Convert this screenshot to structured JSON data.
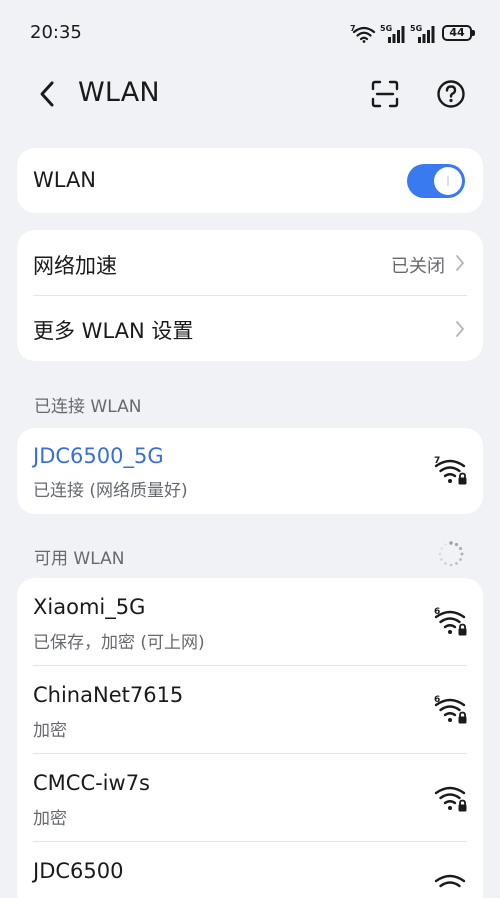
{
  "status_bar": {
    "time": "20:35",
    "network_badges": [
      "7",
      "5G",
      "5G"
    ],
    "battery": "44"
  },
  "header": {
    "title": "WLAN",
    "back_icon": "chevron-left-icon",
    "scan_icon": "scan-icon",
    "help_icon": "help-circle-icon"
  },
  "wlan_toggle": {
    "label": "WLAN",
    "enabled": true
  },
  "settings": [
    {
      "label": "网络加速",
      "value": "已关闭"
    },
    {
      "label": "更多 WLAN 设置",
      "value": ""
    }
  ],
  "connected": {
    "section_label": "已连接 WLAN",
    "network": {
      "name": "JDC6500_5G",
      "status": "已连接 (网络质量好)",
      "badge": "7",
      "locked": true
    }
  },
  "available": {
    "section_label": "可用 WLAN",
    "networks": [
      {
        "name": "Xiaomi_5G",
        "status": "已保存，加密 (可上网)",
        "badge": "6",
        "locked": true
      },
      {
        "name": "ChinaNet7615",
        "status": "加密",
        "badge": "6",
        "locked": true
      },
      {
        "name": "CMCC-iw7s",
        "status": "加密",
        "badge": "",
        "locked": true
      },
      {
        "name": "JDC6500",
        "status": "",
        "badge": "",
        "locked": true
      }
    ]
  },
  "colors": {
    "accent": "#3a7af0",
    "background": "#f1f2f6",
    "card": "#ffffff",
    "secondary_text": "#666a70"
  }
}
